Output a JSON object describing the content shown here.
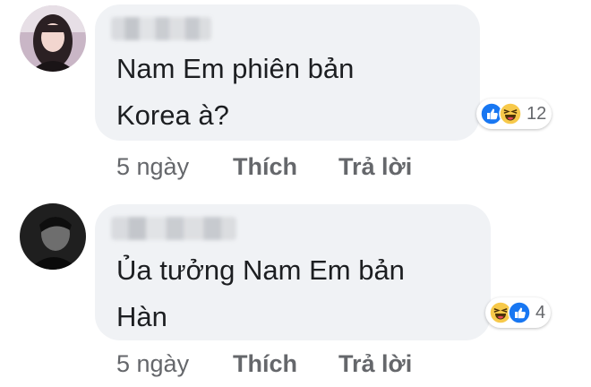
{
  "comments": [
    {
      "text": "Nam Em phiên bản\nKorea à?",
      "reactions": {
        "icons": [
          "like-icon",
          "haha-icon"
        ],
        "count": "12"
      },
      "age": "5 ngày",
      "like_label": "Thích",
      "reply_label": "Trả lời"
    },
    {
      "text": "Ủa tưởng Nam Em bản\nHàn",
      "reactions": {
        "icons": [
          "haha-icon",
          "like-icon"
        ],
        "count": "4"
      },
      "age": "5 ngày",
      "like_label": "Thích",
      "reply_label": "Trả lời"
    }
  ],
  "colors": {
    "bubble": "#f0f2f5",
    "text": "#1c1e21",
    "secondary_text": "#65676b",
    "like_blue": "#1877f2",
    "haha_yellow": "#f7c94a"
  }
}
